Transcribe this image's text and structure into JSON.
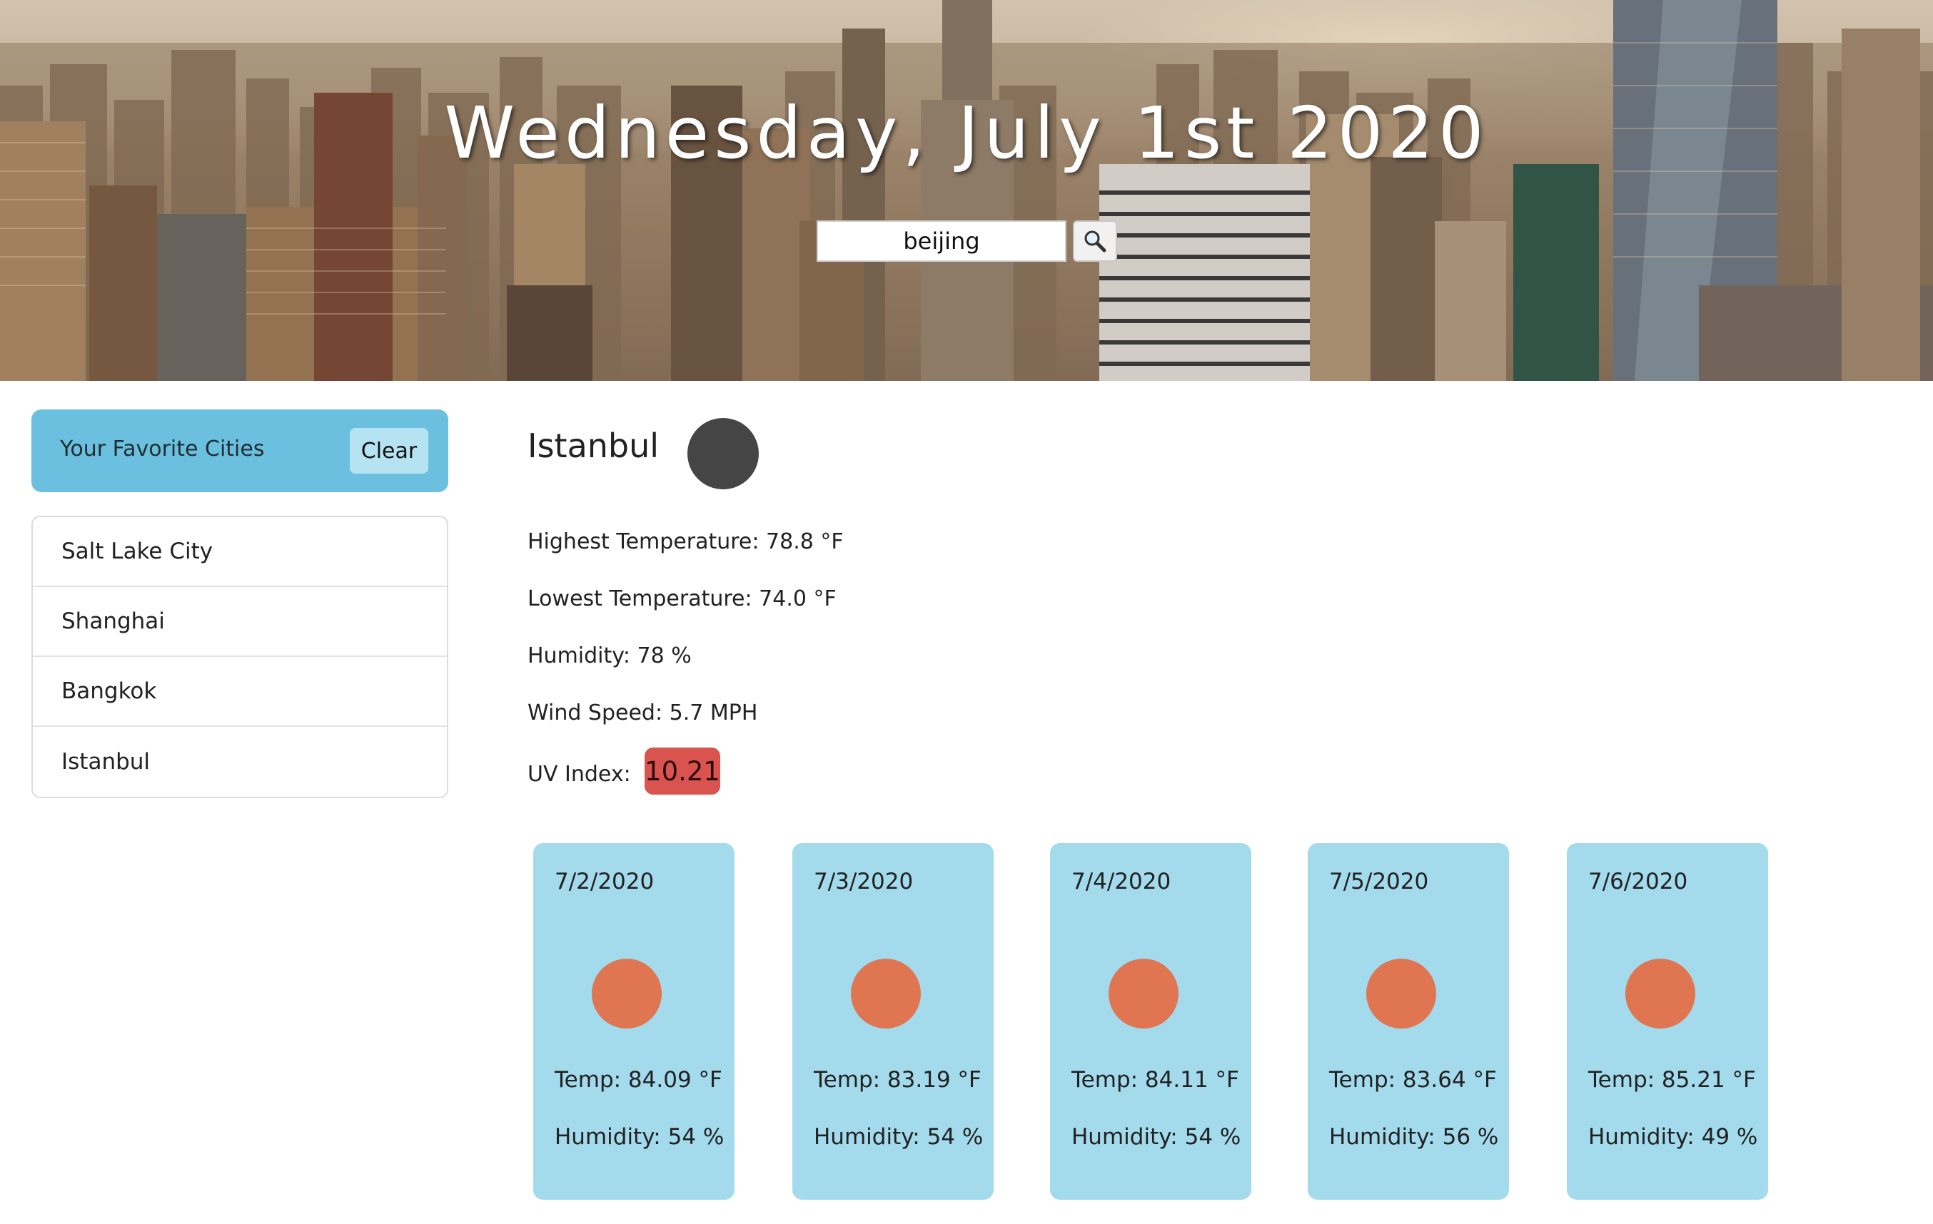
{
  "header": {
    "date_title": "Wednesday, July 1st 2020"
  },
  "search": {
    "value": "beijing",
    "button_icon": "magnifier-icon"
  },
  "favorites": {
    "title": "Your Favorite Cities",
    "clear_label": "Clear",
    "cities": [
      "Salt Lake City",
      "Shanghai",
      "Bangkok",
      "Istanbul"
    ]
  },
  "current": {
    "city": "Istanbul",
    "icon": "weather-icon",
    "high": "Highest Temperature: 78.8 °F",
    "low": "Lowest Temperature: 74.0 °F",
    "humidity": "Humidity: 78 %",
    "wind": "Wind Speed: 5.7 MPH",
    "uv_label": "UV Index:",
    "uv_value": "10.21",
    "uv_color": "#d9534f"
  },
  "forecast": [
    {
      "date": "7/2/2020",
      "temp": "Temp: 84.09 °F",
      "humidity": "Humidity: 54 %"
    },
    {
      "date": "7/3/2020",
      "temp": "Temp: 83.19 °F",
      "humidity": "Humidity: 54 %"
    },
    {
      "date": "7/4/2020",
      "temp": "Temp: 84.11 °F",
      "humidity": "Humidity: 54 %"
    },
    {
      "date": "7/5/2020",
      "temp": "Temp: 83.64 °F",
      "humidity": "Humidity: 56 %"
    },
    {
      "date": "7/6/2020",
      "temp": "Temp: 85.21 °F",
      "humidity": "Humidity: 49 %"
    }
  ],
  "colors": {
    "favorites_header": "#6ac0de",
    "forecast_card": "#a3dbed",
    "forecast_icon": "#e07551",
    "current_icon": "#454545"
  }
}
